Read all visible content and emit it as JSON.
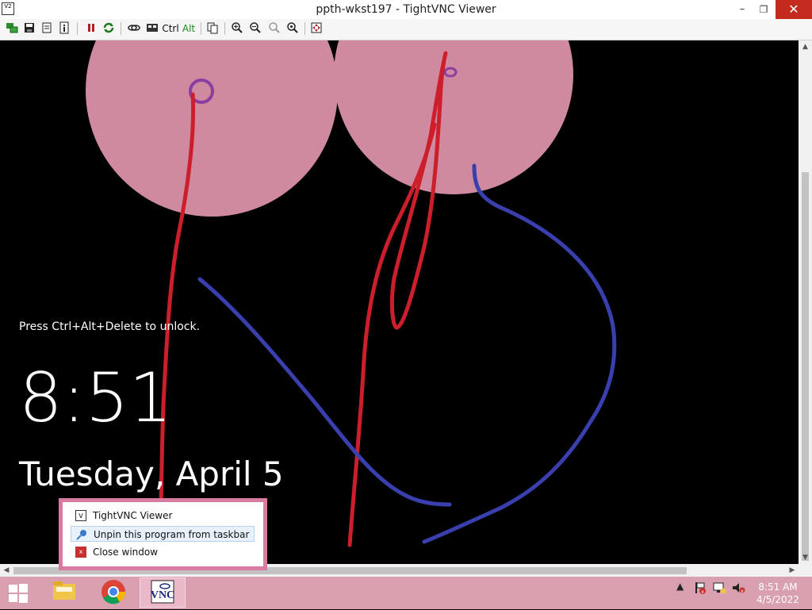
{
  "window": {
    "title": "ppth-wkst197 - TightVNC Viewer",
    "icon_name": "tightvnc-icon",
    "minimize_symbol": "–",
    "maximize_symbol": "❐",
    "close_symbol": "✕"
  },
  "toolbar": {
    "ctrl_label": "Ctrl",
    "alt_label": "Alt"
  },
  "lockscreen": {
    "unlock_text": "Press Ctrl+Alt+Delete to unlock.",
    "time": "8:51",
    "date": "Tuesday, April 5",
    "background_color": "#000000",
    "circle_color": "#d08aa0",
    "red_stroke_color": "#cc1f2b",
    "blue_stroke_color": "#3a3fae",
    "purple_stroke_color": "#8a3fa0"
  },
  "jumplist": {
    "items": [
      {
        "label": "TightVNC Viewer",
        "icon": "tightvnc-icon"
      },
      {
        "label": "Unpin this program from taskbar",
        "icon": "unpin-icon"
      },
      {
        "label": "Close window",
        "icon": "close-window-icon"
      }
    ]
  },
  "taskbar": {
    "color": "#d9a0b0",
    "apps": [
      "file-explorer-icon",
      "chrome-icon",
      "tightvnc-icon"
    ],
    "tray": {
      "time": "8:51 AM",
      "date": "4/5/2022"
    }
  }
}
